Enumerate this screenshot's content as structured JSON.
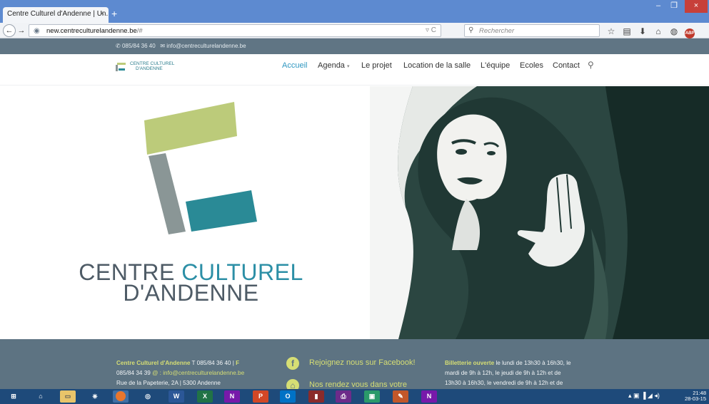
{
  "browser": {
    "tab_title": "Centre Culturel d'Andenne | Un...",
    "tab_close": "×",
    "new_tab": "+",
    "url_host": "new.centreculturelandenne.be",
    "url_rest": "/#",
    "url_tail": "▿ C",
    "search_placeholder": "Rechercher",
    "win_min": "–",
    "win_max": "❐",
    "win_close": "×"
  },
  "topbar": {
    "phone": "085/84 36 40",
    "email": "info@centreculturelandenne.be"
  },
  "logo_small": {
    "line1": "CENTRE CULTUREL",
    "line2": "D'ANDENNE"
  },
  "menu": {
    "items": [
      "Accueil",
      "Agenda",
      "Le projet",
      "Location de la salle",
      "L'équipe",
      "Ecoles",
      "Contact"
    ],
    "active": "Accueil"
  },
  "hero": {
    "title_part1": "CENTRE ",
    "title_part2": "CULTUREL",
    "title_line2": "D'ANDENNE"
  },
  "footer": {
    "col1": {
      "name": "Centre Culturel d'Andenne",
      "tel_label": " T ",
      "tel": "085/84 36 40",
      "sep": " | ",
      "fax_label": "F",
      "fax": "085/84 34 39",
      "at": " @ : ",
      "email": "info@centreculturelandenne.be",
      "address": "Rue de la Papeterie, 2A | 5300 Andenne"
    },
    "col2": {
      "facebook": "Rejoignez nous sur Facebook!",
      "venue": "Nos rendez vous dans votre"
    },
    "col3": {
      "highlight": "Billetterie ouverte",
      "line1": " le lundi de 13h30 à 16h30, le",
      "line2": "mardi de 9h à 12h, le jeudi de 9h à 12h et de",
      "line3": "13h30 à 16h30, le vendredi de 9h à 12h et de"
    }
  },
  "taskbar": {
    "time": "21:48",
    "date": "28-03-15"
  },
  "colors": {
    "accent_blue": "#2f97c1",
    "logo_green": "#bccb7a",
    "logo_grey": "#8a9696",
    "logo_teal": "#2a8a96",
    "footer_bg": "#5d7382",
    "footer_highlight": "#d6de74"
  }
}
